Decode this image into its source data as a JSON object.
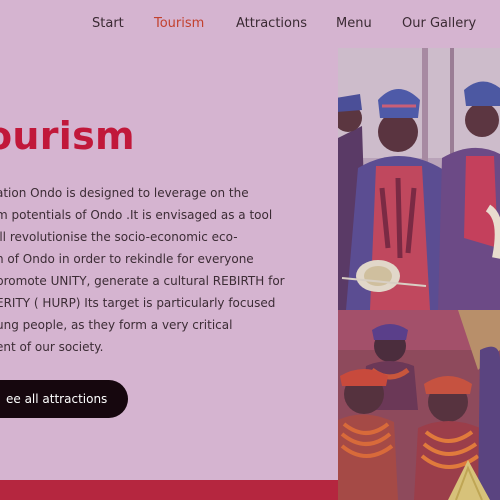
{
  "nav": {
    "items": [
      {
        "label": "Start"
      },
      {
        "label": "Tourism"
      },
      {
        "label": "Attractions"
      },
      {
        "label": "Menu"
      },
      {
        "label": "Our Gallery"
      }
    ],
    "active": "Tourism"
  },
  "hero": {
    "heading": "ourism",
    "paragraph_lines": [
      "ation Ondo is designed to leverage on the",
      "m potentials of Ondo .It is envisaged as a tool",
      "ill revolutionise the socio-economic eco-",
      "n of Ondo in order to rekindle for everyone",
      "promote UNITY, generate a cultural REBIRTH for",
      "ERITY ( HURP) Its target is particularly focused",
      "ung people, as they form a very critical",
      "ent of our society."
    ],
    "cta_label": "ee all attractions"
  },
  "colors": {
    "background": "#d5b4d0",
    "accent": "#c1183a",
    "nav_active": "#c2412e",
    "button": "#16070e",
    "bottom_bar": "#b5263f"
  }
}
